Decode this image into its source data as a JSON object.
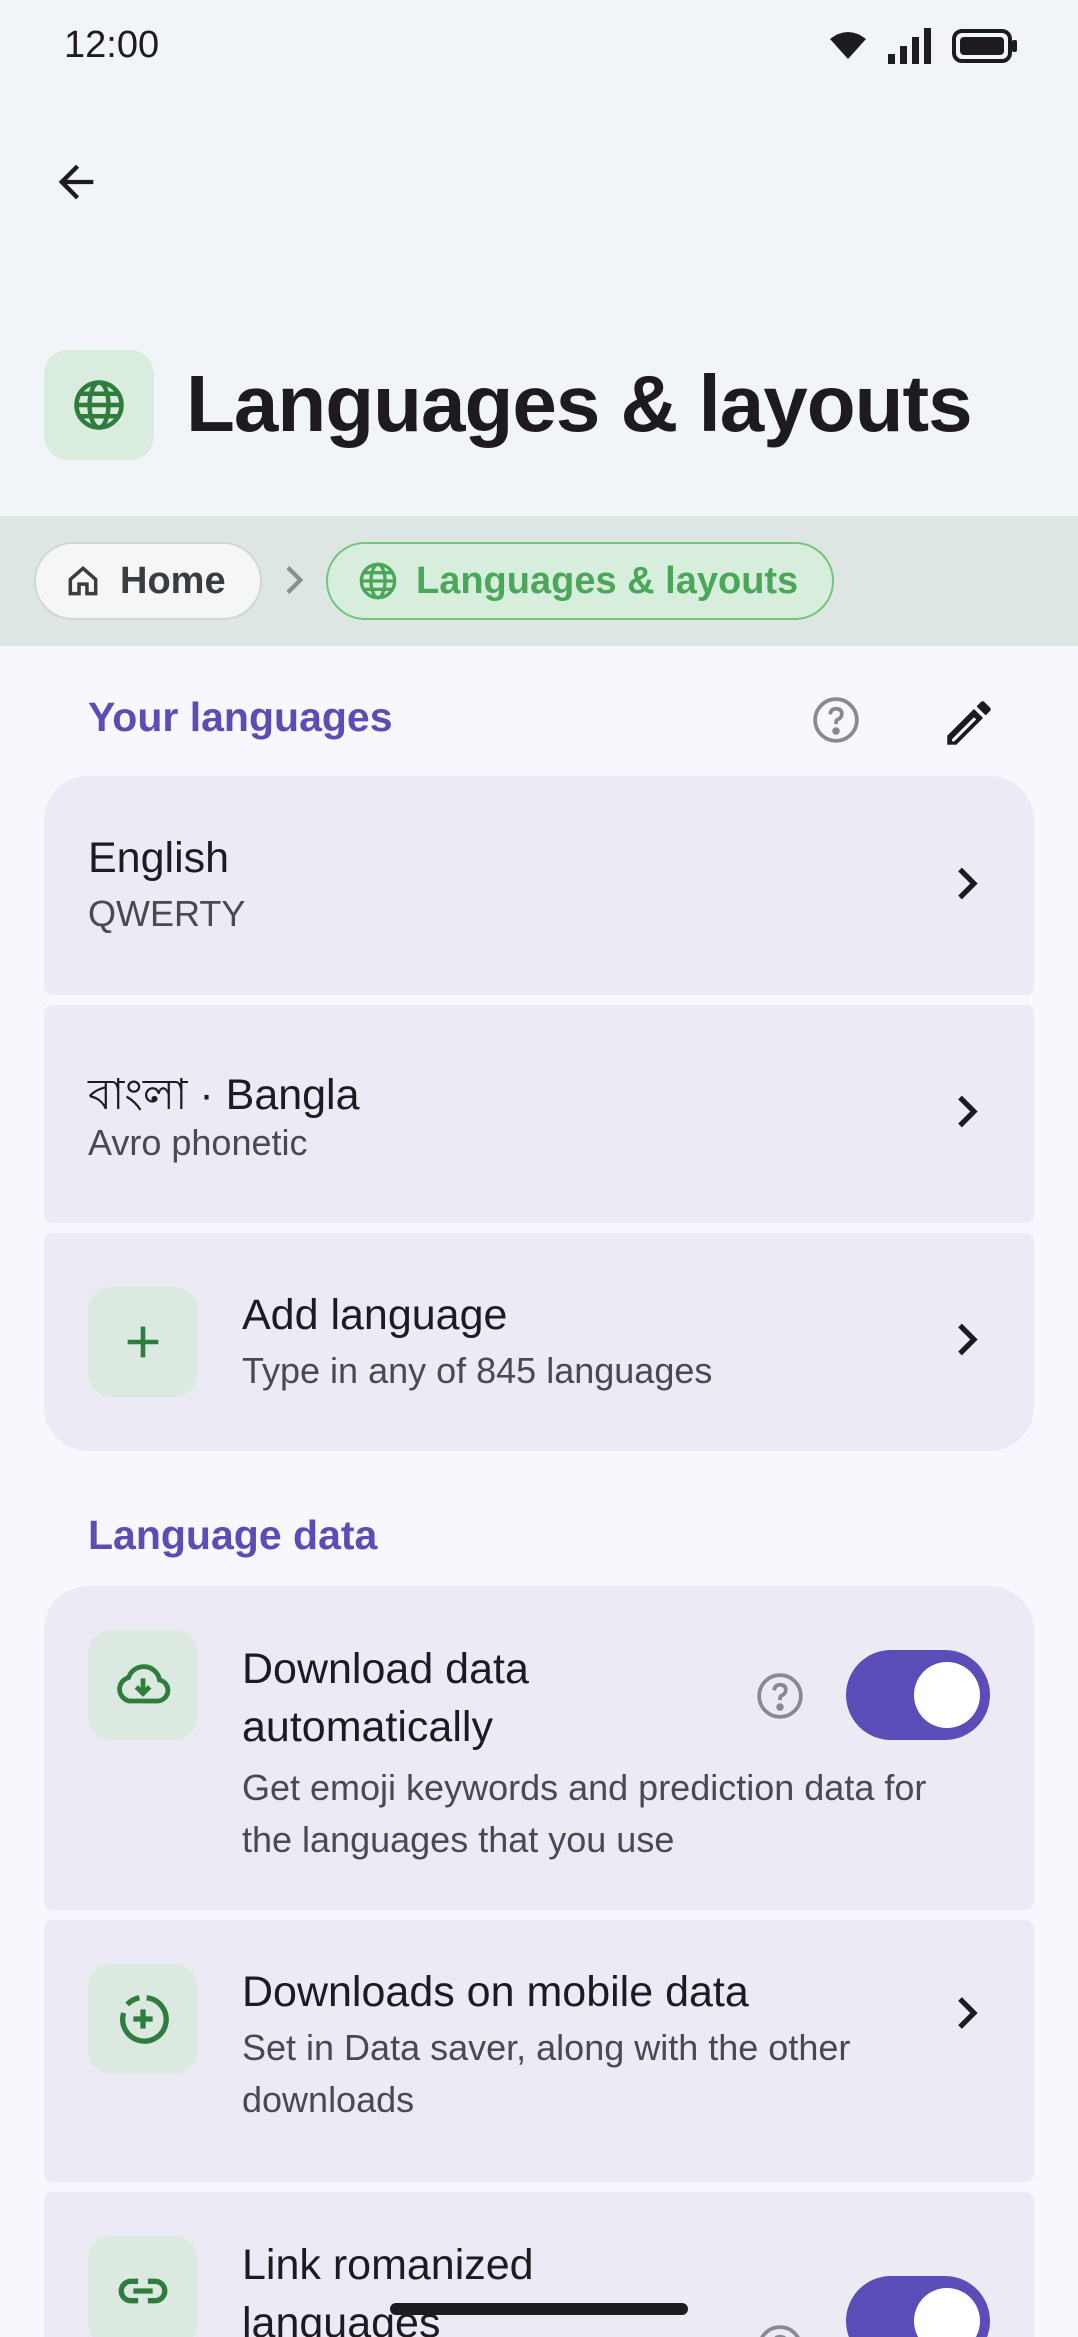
{
  "status_bar": {
    "time": "12:00"
  },
  "header": {
    "title": "Languages & layouts"
  },
  "breadcrumb": {
    "home": "Home",
    "current": "Languages & layouts"
  },
  "your_languages": {
    "section_title": "Your languages",
    "items": [
      {
        "title": "English",
        "subtitle": "QWERTY"
      },
      {
        "title": "বাংলা · Bangla",
        "subtitle": "Avro phonetic"
      }
    ],
    "add": {
      "title": "Add language",
      "subtitle": "Type in any of 845 languages"
    }
  },
  "language_data": {
    "section_title": "Language data",
    "download_auto": {
      "title": "Download data automatically",
      "subtitle": "Get emoji keywords and prediction data for the languages that you use",
      "enabled": true
    },
    "mobile_data": {
      "title": "Downloads on mobile data",
      "subtitle": "Set in Data saver, along with the other downloads"
    },
    "link_romanized": {
      "title": "Link romanized languages",
      "enabled": true
    }
  },
  "colors": {
    "accent": "#5b4db8",
    "green": "#4aa75a",
    "card": "#ecebf5",
    "background": "#f7f7fd"
  }
}
